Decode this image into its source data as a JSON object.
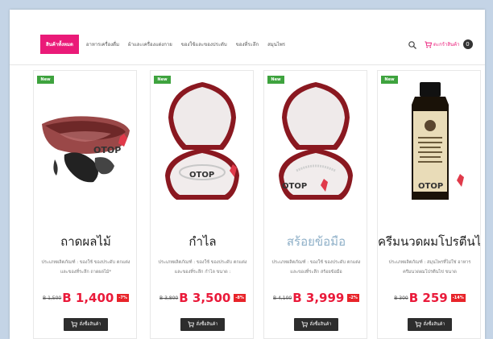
{
  "nav": {
    "items": [
      {
        "label": "สินค้าทั้งหมด",
        "active": true
      },
      {
        "label": "อาหารเครื่องดื่ม",
        "active": false
      },
      {
        "label": "ผ้าและเครื่องแต่งกาย",
        "active": false
      },
      {
        "label": "ของใช้และของประดับ",
        "active": false
      },
      {
        "label": "ของที่ระลึก",
        "active": false
      },
      {
        "label": "สมุนไพร",
        "active": false
      }
    ],
    "search_icon": "search-icon",
    "cart_label": "ตะกร้าสินค้า",
    "cart_count": "0"
  },
  "colors": {
    "accent": "#ea1a78",
    "price": "#ea1a3a",
    "badge": "#3ea33e",
    "button": "#2d2d2d"
  },
  "products": [
    {
      "badge": "New",
      "logo": "OTOP",
      "name": "ถาดผลไม้",
      "desc": "ประเภทผลิตภัณฑ์ : ของใช้ ของประดับ ตกแต่ง และของที่ระลึก ถาดผลไม้*",
      "old_price": "B 1,500",
      "price": "B 1,400",
      "discount": "-7%",
      "buy_label": "สั่งซื้อสินค้า"
    },
    {
      "badge": "New",
      "logo": "OTOP",
      "name": "กำไล",
      "desc": "ประเภทผลิตภัณฑ์ : ของใช้ ของประดับ ตกแต่ง และของที่ระลึก กำไล ขนาด :",
      "old_price": "B 3,800",
      "price": "B 3,500",
      "discount": "-8%",
      "buy_label": "สั่งซื้อสินค้า"
    },
    {
      "badge": "New",
      "logo": "OTOP",
      "name": "สร้อยข้อมือ",
      "desc": "ประเภทผลิตภัณฑ์ : ของใช้ ของประดับ ตกแต่ง และของที่ระลึก สร้อยข้อมือ",
      "old_price": "B 4,100",
      "price": "B 3,999",
      "discount": "-2%",
      "buy_label": "สั่งซื้อสินค้า"
    },
    {
      "badge": "New",
      "logo": "OTOP",
      "name": "ครีมนวดผมโปรตีนไข่",
      "desc": "ประเภทผลิตภัณฑ์ : สมุนไพรที่ไม่ใช่ อาหาร ครีมนวดผมโปรตีนไข่ ขนาด",
      "old_price": "B 300",
      "price": "B 259",
      "discount": "-14%",
      "buy_label": "สั่งซื้อสินค้า"
    }
  ]
}
